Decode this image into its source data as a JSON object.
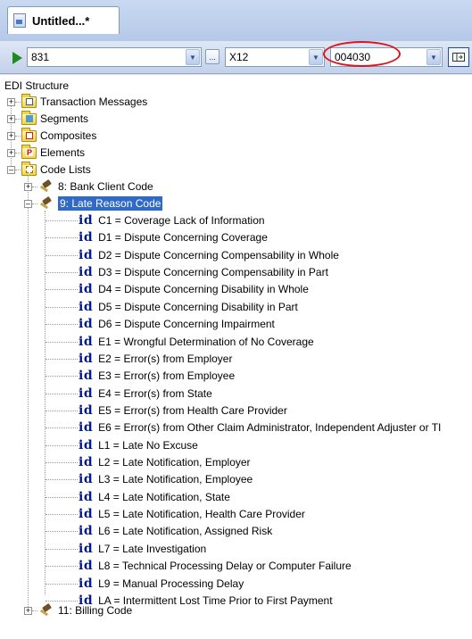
{
  "tab": {
    "title": "Untitled...*",
    "icon": "edi-document-icon"
  },
  "toolbar": {
    "run_icon": "play-icon",
    "transaction_value": "831",
    "standard_value": "X12",
    "version_value": "004030",
    "ellipsis_label": "...",
    "view_icon": "layout-toggle-icon",
    "highlight_color": "#e0121b"
  },
  "tree": {
    "root": "EDI Structure",
    "top_nodes": [
      {
        "label": "Transaction Messages",
        "icon": "envelope-folder-icon"
      },
      {
        "label": "Segments",
        "icon": "segment-folder-icon"
      },
      {
        "label": "Composites",
        "icon": "composite-folder-icon"
      },
      {
        "label": "Elements",
        "icon": "element-folder-icon"
      },
      {
        "label": "Code Lists",
        "icon": "code-list-folder-icon"
      }
    ],
    "code_lists": [
      {
        "label": "8: Bank Client Code"
      },
      {
        "label": "9: Late Reason Code",
        "selected": true
      },
      {
        "label": "11: Billing Code"
      }
    ],
    "id_glyph": "id",
    "late_reason_codes": [
      "C1 = Coverage Lack of Information",
      "D1 = Dispute Concerning Coverage",
      "D2 = Dispute Concerning Compensability in Whole",
      "D3 = Dispute Concerning Compensability in Part",
      "D4 = Dispute Concerning Disability in Whole",
      "D5 = Dispute Concerning Disability in Part",
      "D6 = Dispute Concerning Impairment",
      "E1 = Wrongful Determination of No Coverage",
      "E2 = Error(s) from Employer",
      "E3 = Error(s) from Employee",
      "E4 = Error(s) from State",
      "E5 = Error(s) from Health Care Provider",
      "E6 = Error(s) from Other Claim Administrator, Independent Adjuster or TI",
      "L1 = Late No Excuse",
      "L2 = Late Notification, Employer",
      "L3 = Late Notification, Employee",
      "L4 = Late Notification, State",
      "L5 = Late Notification, Health Care Provider",
      "L6 = Late Notification, Assigned Risk",
      "L7 = Late Investigation",
      "L8 = Technical Processing Delay or Computer Failure",
      "L9 = Manual Processing Delay",
      "LA = Intermittent Lost Time Prior to First Payment"
    ]
  }
}
